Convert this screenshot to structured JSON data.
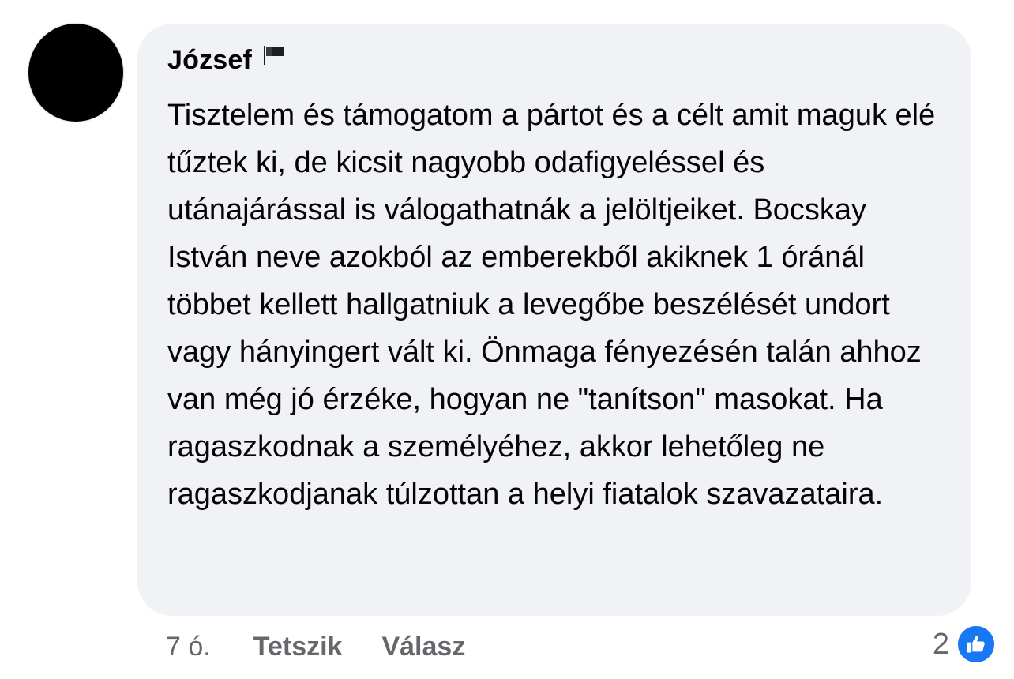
{
  "comment": {
    "author": "József",
    "author_icon": "flag-icon",
    "text": "Tisztelem és támogatom a pártot és a célt amit maguk elé tűztek ki, de kicsit nagyobb odafigyeléssel és utánajárással is válogathatnák a jelöltjeiket. Bocskay István neve azokból az emberekből akiknek 1 óránál többet kellett hallgatniuk a levegőbe beszélését undort vagy hányingert vált ki. Önmaga fényezésén talán ahhoz van még jó érzéke, hogyan ne \"tanítson\" masokat. Ha ragaszkodnak a személyéhez, akkor lehetőleg ne ragaszkodjanak túlzottan a helyi fiatalok szavazataira."
  },
  "footer": {
    "time": "7 ó.",
    "like_label": "Tetszik",
    "reply_label": "Válasz"
  },
  "reactions": {
    "count": "2",
    "icon": "thumbs-up-icon",
    "color": "#1877f2"
  },
  "colors": {
    "bubble_bg": "#f0f2f5",
    "secondary_text": "#65676b",
    "primary_text": "#050505"
  }
}
